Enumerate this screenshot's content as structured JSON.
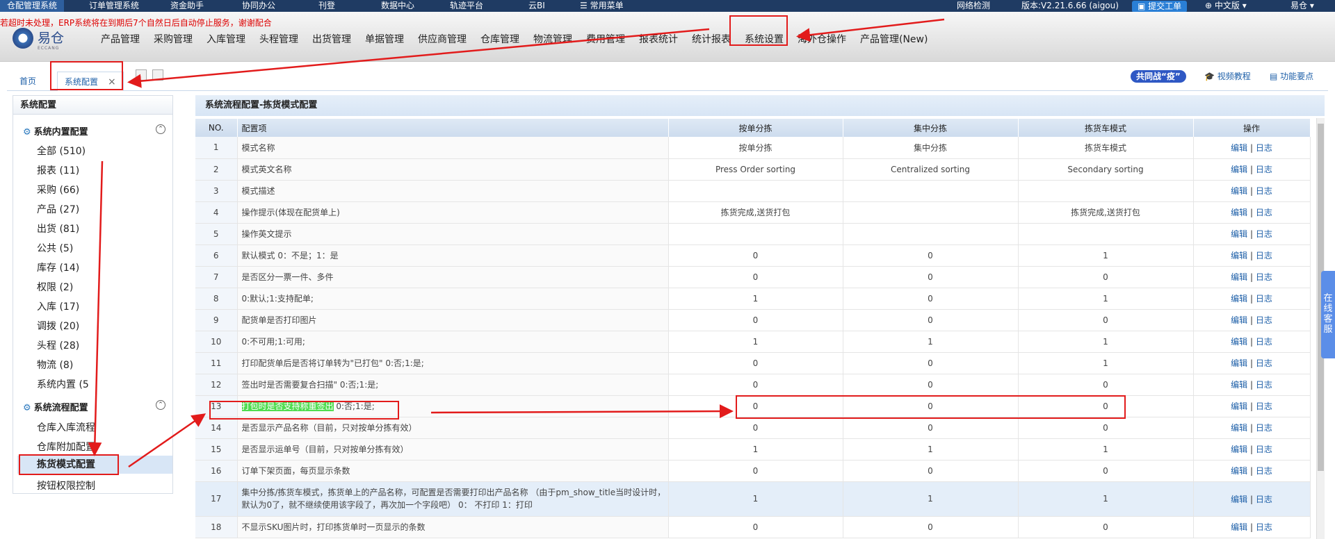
{
  "topbar": {
    "items": [
      "仓配管理系统",
      "订单管理系统",
      "资金助手",
      "协同办公",
      "刊登",
      "数据中心",
      "轨迹平台",
      "云BI"
    ],
    "common_menu": "常用菜单",
    "network": "网络检测",
    "version": "版本:V2.21.6.66 (aigou)",
    "ticket": "提交工单",
    "lang": "中文版",
    "user": "易仓"
  },
  "notice": "若超时未处理，ERP系统将在到期后7个自然日后自动停止服务，谢谢配合",
  "logo": {
    "text": "易仓",
    "sub": "ECCANG"
  },
  "nav": [
    "产品管理",
    "采购管理",
    "入库管理",
    "头程管理",
    "出货管理",
    "单据管理",
    "供应商管理",
    "仓库管理",
    "物流管理",
    "费用管理",
    "报表统计",
    "统计报表",
    "系统设置",
    "海外仓操作",
    "产品管理(New)"
  ],
  "tabs": {
    "home": "首页",
    "active": "系统配置",
    "close": "×"
  },
  "right_links": {
    "badge": "共同战“疫”",
    "video": "视频教程",
    "features": "功能要点"
  },
  "sidebar": {
    "title": "系统配置",
    "group1": "系统内置配置",
    "items": [
      "全部 (510)",
      "报表 (11)",
      "采购 (66)",
      "产品 (27)",
      "出货 (81)",
      "公共 (5)",
      "库存 (14)",
      "权限 (2)",
      "入库 (17)",
      "调拨 (20)",
      "头程 (28)",
      "物流 (8)",
      "系统内置 (5"
    ],
    "group2": "系统流程配置",
    "items2": [
      "仓库入库流程",
      "仓库附加配置",
      "拣货模式配置",
      "按钮权限控制"
    ]
  },
  "main": {
    "title": "系统流程配置-拣货模式配置",
    "headers": [
      "NO.",
      "配置项",
      "按单分拣",
      "集中分拣",
      "拣货车模式",
      "操作"
    ],
    "edit": "编辑",
    "sep": "|",
    "log": "日志",
    "rows": [
      {
        "no": "1",
        "cfg": "模式名称",
        "a": "按单分拣",
        "b": "集中分拣",
        "c": "拣货车模式"
      },
      {
        "no": "2",
        "cfg": "模式英文名称",
        "a": "Press Order sorting",
        "b": "Centralized sorting",
        "c": "Secondary sorting"
      },
      {
        "no": "3",
        "cfg": "模式描述",
        "a": "",
        "b": "",
        "c": ""
      },
      {
        "no": "4",
        "cfg": "操作提示(体现在配货单上)",
        "a": "拣货完成,送货打包",
        "b": "",
        "c": "拣货完成,送货打包"
      },
      {
        "no": "5",
        "cfg": "操作英文提示",
        "a": "",
        "b": "",
        "c": ""
      },
      {
        "no": "6",
        "cfg": "默认模式 0：不是；1：是",
        "a": "0",
        "b": "0",
        "c": "1"
      },
      {
        "no": "7",
        "cfg": "是否区分一票一件、多件",
        "a": "0",
        "b": "0",
        "c": "0"
      },
      {
        "no": "8",
        "cfg": "0:默认;1:支持配单;",
        "a": "1",
        "b": "0",
        "c": "1"
      },
      {
        "no": "9",
        "cfg": "配货单是否打印图片",
        "a": "0",
        "b": "0",
        "c": "0"
      },
      {
        "no": "10",
        "cfg": "0:不可用;1:可用;",
        "a": "1",
        "b": "1",
        "c": "1"
      },
      {
        "no": "11",
        "cfg": "打印配货单后是否将订单转为\"已打包\" 0:否;1:是;",
        "a": "0",
        "b": "0",
        "c": "1"
      },
      {
        "no": "12",
        "cfg": "签出时是否需要复合扫描\" 0:否;1:是;",
        "a": "0",
        "b": "0",
        "c": "0"
      },
      {
        "no": "13",
        "cfg_hl": "打包时是否支持称重签出",
        "cfg_rest": " 0:否;1:是;",
        "a": "0",
        "b": "0",
        "c": "0"
      },
      {
        "no": "14",
        "cfg": "是否显示产品名称（目前，只对按单分拣有效）",
        "a": "0",
        "b": "0",
        "c": "0"
      },
      {
        "no": "15",
        "cfg": "是否显示运单号（目前，只对按单分拣有效）",
        "a": "1",
        "b": "1",
        "c": "1"
      },
      {
        "no": "16",
        "cfg": "订单下架页面，每页显示条数",
        "a": "0",
        "b": "0",
        "c": "0"
      },
      {
        "no": "17",
        "cfg": "集中分拣/拣货车模式，拣货单上的产品名称，可配置是否需要打印出产品名称 （由于pm_show_title当时设计时，默认为0了，就不继续使用该字段了，再次加一个字段吧） 0： 不打印 1：打印",
        "a": "1",
        "b": "1",
        "c": "1"
      },
      {
        "no": "18",
        "cfg": "不显示SKU图片时，打印拣货单时一页显示的条数",
        "a": "0",
        "b": "0",
        "c": "0"
      }
    ]
  },
  "kefu": "在线客服",
  "colors": {
    "topbar": "#1f3b63",
    "link": "#1d5fa8",
    "annotation": "#e21b1b",
    "highlight": "#4fdc4f"
  }
}
